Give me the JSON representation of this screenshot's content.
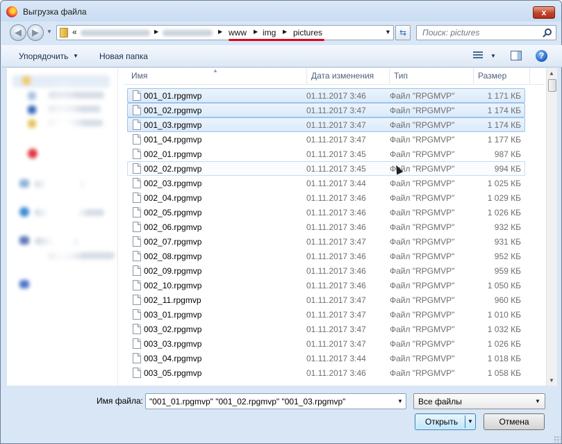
{
  "window": {
    "title": "Выгрузка файла",
    "close_label": "x"
  },
  "address": {
    "lead": "«",
    "crumbs": [
      "www",
      "img",
      "pictures"
    ],
    "search_placeholder": "Поиск: pictures"
  },
  "toolbar": {
    "organize_label": "Упорядочить",
    "new_folder_label": "Новая папка",
    "help_label": "?"
  },
  "columns": {
    "name": "Имя",
    "date": "Дата изменения",
    "type": "Тип",
    "size": "Размер"
  },
  "files": [
    {
      "name": "001_01.rpgmvp",
      "date": "01.11.2017 3:46",
      "type": "Файл \"RPGMVP\"",
      "size": "1 171 КБ",
      "state": "selected"
    },
    {
      "name": "001_02.rpgmvp",
      "date": "01.11.2017 3:47",
      "type": "Файл \"RPGMVP\"",
      "size": "1 174 КБ",
      "state": "selected"
    },
    {
      "name": "001_03.rpgmvp",
      "date": "01.11.2017 3:47",
      "type": "Файл \"RPGMVP\"",
      "size": "1 174 КБ",
      "state": "selected"
    },
    {
      "name": "001_04.rpgmvp",
      "date": "01.11.2017 3:47",
      "type": "Файл \"RPGMVP\"",
      "size": "1 177 КБ",
      "state": "normal"
    },
    {
      "name": "002_01.rpgmvp",
      "date": "01.11.2017 3:45",
      "type": "Файл \"RPGMVP\"",
      "size": "987 КБ",
      "state": "normal"
    },
    {
      "name": "002_02.rpgmvp",
      "date": "01.11.2017 3:45",
      "type": "Файл \"RPGMVP\"",
      "size": "994 КБ",
      "state": "hover"
    },
    {
      "name": "002_03.rpgmvp",
      "date": "01.11.2017 3:44",
      "type": "Файл \"RPGMVP\"",
      "size": "1 025 КБ",
      "state": "normal"
    },
    {
      "name": "002_04.rpgmvp",
      "date": "01.11.2017 3:46",
      "type": "Файл \"RPGMVP\"",
      "size": "1 029 КБ",
      "state": "normal"
    },
    {
      "name": "002_05.rpgmvp",
      "date": "01.11.2017 3:46",
      "type": "Файл \"RPGMVP\"",
      "size": "1 026 КБ",
      "state": "normal"
    },
    {
      "name": "002_06.rpgmvp",
      "date": "01.11.2017 3:46",
      "type": "Файл \"RPGMVP\"",
      "size": "932 КБ",
      "state": "normal"
    },
    {
      "name": "002_07.rpgmvp",
      "date": "01.11.2017 3:47",
      "type": "Файл \"RPGMVP\"",
      "size": "931 КБ",
      "state": "normal"
    },
    {
      "name": "002_08.rpgmvp",
      "date": "01.11.2017 3:46",
      "type": "Файл \"RPGMVP\"",
      "size": "952 КБ",
      "state": "normal"
    },
    {
      "name": "002_09.rpgmvp",
      "date": "01.11.2017 3:46",
      "type": "Файл \"RPGMVP\"",
      "size": "959 КБ",
      "state": "normal"
    },
    {
      "name": "002_10.rpgmvp",
      "date": "01.11.2017 3:46",
      "type": "Файл \"RPGMVP\"",
      "size": "1 050 КБ",
      "state": "normal"
    },
    {
      "name": "002_11.rpgmvp",
      "date": "01.11.2017 3:47",
      "type": "Файл \"RPGMVP\"",
      "size": "960 КБ",
      "state": "normal"
    },
    {
      "name": "003_01.rpgmvp",
      "date": "01.11.2017 3:47",
      "type": "Файл \"RPGMVP\"",
      "size": "1 010 КБ",
      "state": "normal"
    },
    {
      "name": "003_02.rpgmvp",
      "date": "01.11.2017 3:47",
      "type": "Файл \"RPGMVP\"",
      "size": "1 032 КБ",
      "state": "normal"
    },
    {
      "name": "003_03.rpgmvp",
      "date": "01.11.2017 3:47",
      "type": "Файл \"RPGMVP\"",
      "size": "1 026 КБ",
      "state": "normal"
    },
    {
      "name": "003_04.rpgmvp",
      "date": "01.11.2017 3:44",
      "type": "Файл \"RPGMVP\"",
      "size": "1 018 КБ",
      "state": "normal"
    },
    {
      "name": "003_05.rpgmvp",
      "date": "01.11.2017 3:46",
      "type": "Файл \"RPGMVP\"",
      "size": "1 058 КБ",
      "state": "normal"
    }
  ],
  "bottom": {
    "filename_label": "Имя файла:",
    "filename_value": "\"001_01.rpgmvp\" \"001_02.rpgmvp\" \"001_03.rpgmvp\"",
    "filter_value": "Все файлы",
    "open_label": "Открыть",
    "cancel_label": "Отмена"
  },
  "colors": {
    "selection": "#dbeafa",
    "selection_border": "#9cc3ea",
    "annotation_underline": "#e2001a",
    "window_frame": "#d9e6f5"
  }
}
